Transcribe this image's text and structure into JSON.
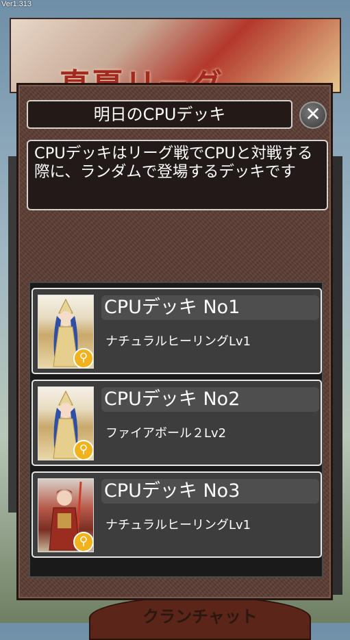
{
  "version": "Ver1.313",
  "background": {
    "banner_title": "真夏リーグ",
    "bottom_tab_label": "クランチャット"
  },
  "dialog": {
    "title": "明日のCPUデッキ",
    "close_icon": "close-icon",
    "description": "CPUデッキはリーグ戦でCPUと対戦する際に、ランダムで登場するデッキです",
    "decks": [
      {
        "name": "CPUデッキ  No1",
        "skill": "ナチュラルヒーリングLv1",
        "portrait": "blue"
      },
      {
        "name": "CPUデッキ  No2",
        "skill": "ファイアボール２Lv2",
        "portrait": "blue"
      },
      {
        "name": "CPUデッキ  No3",
        "skill": "ナチュラルヒーリングLv1",
        "portrait": "red"
      }
    ]
  },
  "colors": {
    "dialog_bg": "#5e4036",
    "magnify_badge": "#f2b21b"
  }
}
